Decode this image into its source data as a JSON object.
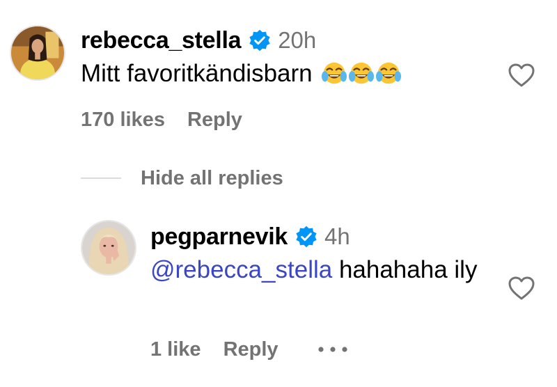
{
  "comments": [
    {
      "username": "rebecca_stella",
      "verified": true,
      "timestamp": "20h",
      "text": "Mitt favoritkändisbarn",
      "emojis": [
        "face-with-tears-of-joy",
        "face-with-tears-of-joy",
        "face-with-tears-of-joy"
      ],
      "likes_label": "170 likes",
      "reply_label": "Reply",
      "like_icon": "heart-outline-icon"
    }
  ],
  "replies_toggle": {
    "label": "Hide all replies"
  },
  "replies": [
    {
      "username": "pegparnevik",
      "verified": true,
      "timestamp": "4h",
      "mention": "@rebecca_stella",
      "text": " hahahaha ily",
      "likes_label": "1 like",
      "reply_label": "Reply",
      "more_icon": "ellipsis-icon",
      "like_icon": "heart-outline-icon"
    }
  ],
  "colors": {
    "secondary_text": "#737373",
    "mention": "#3b46c4",
    "verified_badge": "#0095f6",
    "divider": "#dbdbdb"
  }
}
